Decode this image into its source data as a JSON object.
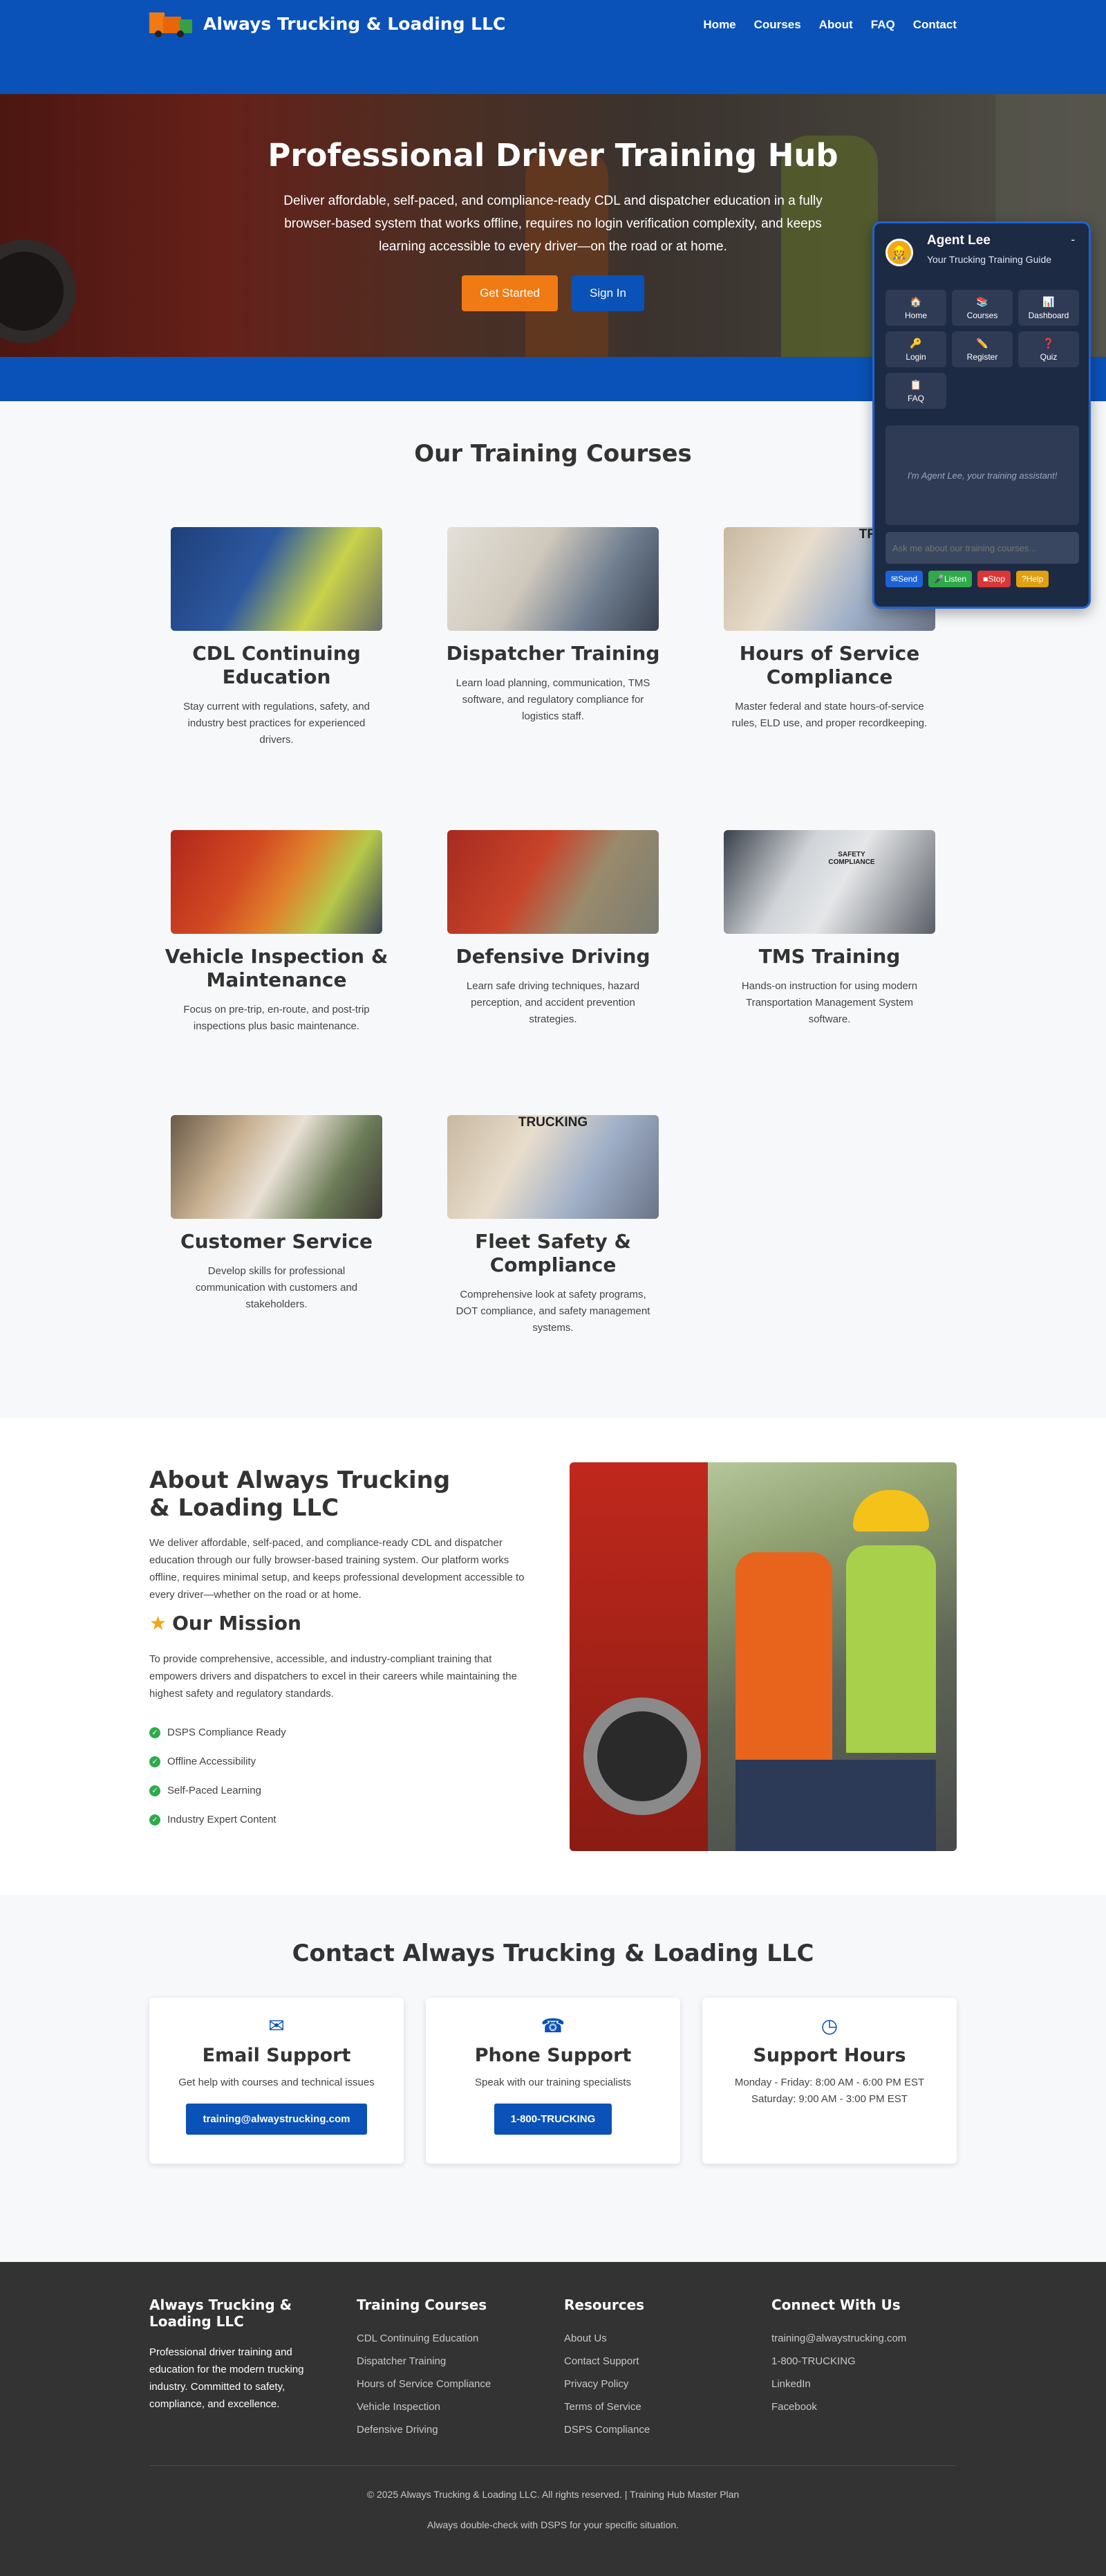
{
  "header": {
    "brand": "Always Trucking & Loading LLC",
    "nav": [
      "Home",
      "Courses",
      "About",
      "FAQ",
      "Contact"
    ]
  },
  "hero": {
    "title": "Professional Driver Training Hub",
    "subtitle": "Deliver affordable, self-paced, and compliance-ready CDL and dispatcher education in a fully browser-based system that works offline, requires no login verification complexity, and keeps learning accessible to every driver—on the road or at home.",
    "primary_button": "Get Started",
    "secondary_button": "Sign In"
  },
  "courses": {
    "title": "Our Training Courses",
    "items": [
      {
        "title": "CDL Continuing Education",
        "desc": "Stay current with regulations, safety, and industry best practices for experienced drivers.",
        "image": "Driver and instructor at truck steering wheel"
      },
      {
        "title": "Dispatcher Training",
        "desc": "Learn load planning, communication, TMS software, and regulatory compliance for logistics staff.",
        "image": "Dispatch office with monitors and whiteboard"
      },
      {
        "title": "Hours of Service Compliance",
        "desc": "Master federal and state hours-of-service rules, ELD use, and proper recordkeeping.",
        "image": "Trainer holding Always Trucking Training sign",
        "image_text": "TRUCKING"
      },
      {
        "title": "Vehicle Inspection & Maintenance",
        "desc": "Focus on pre-trip, en-route, and post-trip inspections plus basic maintenance.",
        "image": "Two workers in safety vests beside red truck"
      },
      {
        "title": "Defensive Driving",
        "desc": "Learn safe driving techniques, hazard perception, and accident prevention strategies.",
        "image": "Instructor and driver near red truck"
      },
      {
        "title": "TMS Training",
        "desc": "Hands-on instruction for using modern Transportation Management System software.",
        "image": "Presenter in front of Safety Compliance screen",
        "image_text": "SAFETY COMPLIANCE"
      },
      {
        "title": "Customer Service",
        "desc": "Develop skills for professional communication with customers and stakeholders.",
        "image": "Team meeting holding Always Trucking Training sign"
      },
      {
        "title": "Fleet Safety & Compliance",
        "desc": "Comprehensive look at safety programs, DOT compliance, and safety management systems.",
        "image": "Training session with headset operators",
        "image_text": "TRUCKING"
      }
    ]
  },
  "about": {
    "title": "About Always Trucking & Loading LLC",
    "desc": "We deliver affordable, self-paced, and compliance-ready CDL and dispatcher education through our fully browser-based training system. Our platform works offline, requires minimal setup, and keeps professional development accessible to every driver—whether on the road or at home.",
    "mission_title": "Our Mission",
    "mission": "To provide comprehensive, accessible, and industry-compliant training that empowers drivers and dispatchers to excel in their careers while maintaining the highest safety and regulatory standards.",
    "features": [
      "DSPS Compliance Ready",
      "Offline Accessibility",
      "Self-Paced Learning",
      "Industry Expert Content"
    ]
  },
  "contact": {
    "title": "Contact Always Trucking & Loading LLC",
    "cards": [
      {
        "icon": "envelope-icon",
        "title": "Email Support",
        "desc": "Get help with courses and technical issues",
        "button": "training@alwaystrucking.com"
      },
      {
        "icon": "phone-icon",
        "title": "Phone Support",
        "desc": "Speak with our training specialists",
        "button": "1-800-TRUCKING"
      },
      {
        "icon": "clock-icon",
        "title": "Support Hours",
        "line1": "Monday - Friday: 8:00 AM - 6:00 PM EST",
        "line2": "Saturday: 9:00 AM - 3:00 PM EST"
      }
    ]
  },
  "footer": {
    "brand_title": "Always Trucking & Loading LLC",
    "brand_desc": "Professional driver training and education for the modern trucking industry. Committed to safety, compliance, and excellence.",
    "courses_title": "Training Courses",
    "courses": [
      "CDL Continuing Education",
      "Dispatcher Training",
      "Hours of Service Compliance",
      "Vehicle Inspection",
      "Defensive Driving"
    ],
    "resources_title": "Resources",
    "resources": [
      "About Us",
      "Contact Support",
      "Privacy Policy",
      "Terms of Service",
      "DSPS Compliance"
    ],
    "connect_title": "Connect With Us",
    "connect": [
      "training@alwaystrucking.com",
      "1-800-TRUCKING",
      "LinkedIn",
      "Facebook"
    ],
    "copyright": "© 2025 Always Trucking & Loading LLC. All rights reserved. | Training Hub Master Plan",
    "disclaimer": "Always double-check with DSPS for your specific situation."
  },
  "chat": {
    "name": "Agent Lee",
    "subtitle": "Your Trucking Training Guide",
    "minimize": "-",
    "buttons": [
      {
        "icon": "🏠",
        "label": "Home"
      },
      {
        "icon": "📚",
        "label": "Courses"
      },
      {
        "icon": "📊",
        "label": "Dashboard"
      },
      {
        "icon": "🔑",
        "label": "Login"
      },
      {
        "icon": "✏️",
        "label": "Register"
      },
      {
        "icon": "❓",
        "label": "Quiz"
      },
      {
        "icon": "📋",
        "label": "FAQ"
      }
    ],
    "message": "I'm Agent Lee, your training assistant!",
    "input_placeholder": "Ask me about our training courses...",
    "actions": [
      {
        "label": "Send",
        "color": "#1d63d4"
      },
      {
        "label": "Listen",
        "color": "#2eaa4a"
      },
      {
        "label": "Stop",
        "color": "#d93636"
      },
      {
        "label": "Help",
        "color": "#e0a010"
      }
    ]
  },
  "colors": {
    "primary": "#0a52b8",
    "accent": "#f07b14",
    "chat_bg": "#1d2a44",
    "footer_bg": "#333333"
  }
}
